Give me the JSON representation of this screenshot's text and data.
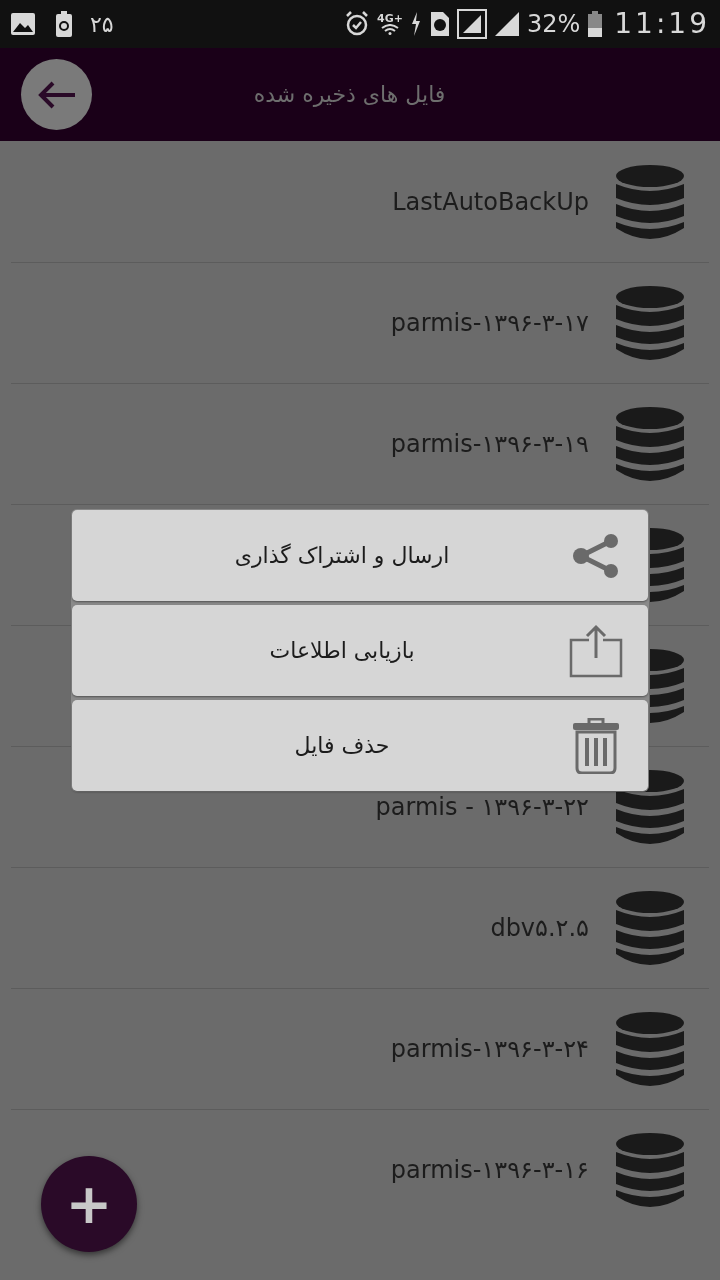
{
  "status_bar": {
    "notification_count": "۲۵",
    "network_label": "4G+",
    "battery_percent": "32%",
    "time": "11:19"
  },
  "header": {
    "title": "فایل های ذخیره شده"
  },
  "files": [
    {
      "kind": "file",
      "name": "LastAutoBackUp"
    },
    {
      "kind": "file",
      "name": "parmis-۱۳۹۶-۳-۱۷"
    },
    {
      "kind": "file",
      "name": "parmis-۱۳۹۶-۳-۱۹"
    },
    {
      "kind": "covered"
    },
    {
      "kind": "covered"
    },
    {
      "kind": "file",
      "name": "parmis - ۱۳۹۶-۳-۲۲"
    },
    {
      "kind": "file",
      "name": "dbv۵.۲.۵"
    },
    {
      "kind": "file",
      "name": "parmis-۱۳۹۶-۳-۲۴"
    },
    {
      "kind": "file",
      "name": "parmis-۱۳۹۶-۳-۱۶"
    }
  ],
  "menu": [
    {
      "kind": "share",
      "label": "ارسال و اشتراک گذاری"
    },
    {
      "kind": "export",
      "label": "بازیابی اطلاعات"
    },
    {
      "kind": "delete",
      "label": "حذف فایل"
    }
  ],
  "fab": {
    "label": "+"
  }
}
